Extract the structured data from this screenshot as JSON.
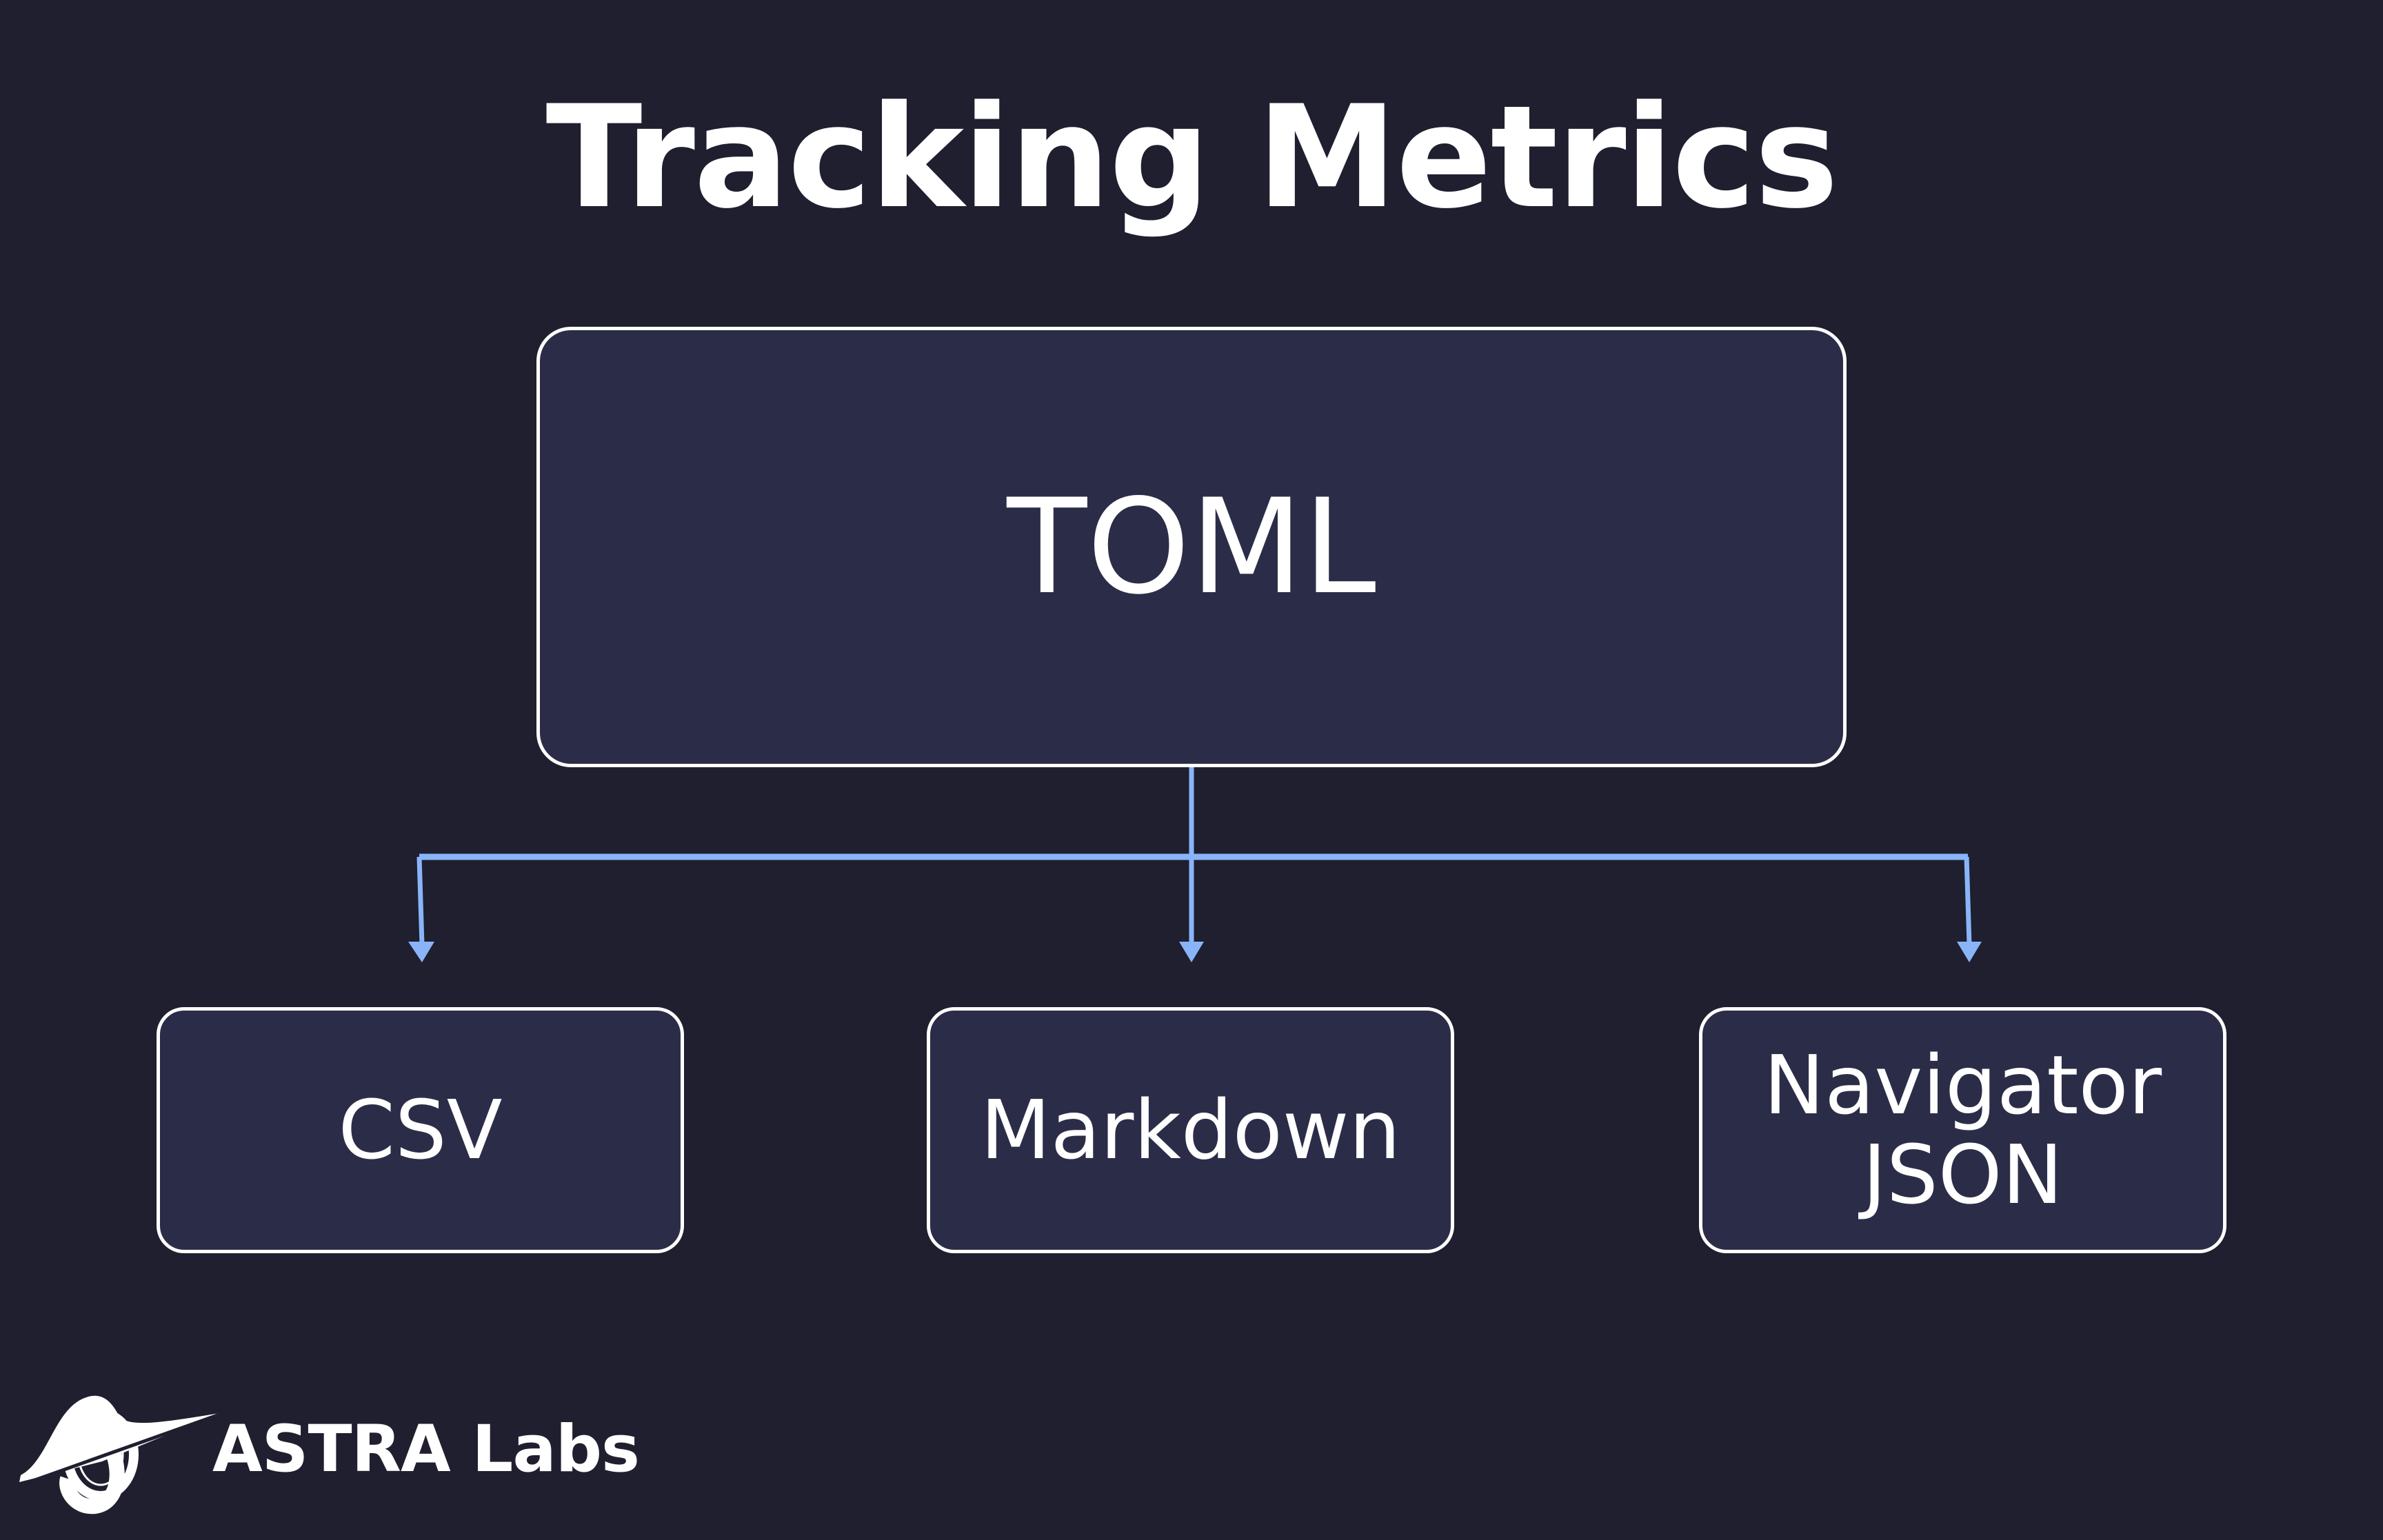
{
  "title": "Tracking Metrics",
  "root": {
    "label": "TOML"
  },
  "children": [
    {
      "label": "CSV"
    },
    {
      "label": "Markdown"
    },
    {
      "label": "Navigator JSON",
      "lines": [
        "Navigator",
        "JSON"
      ]
    }
  ],
  "brand": {
    "name": "ASTRA Labs"
  },
  "colors": {
    "background": "#1f1f2f",
    "box_fill": "#2b2d48",
    "connector": "#8ab4f8"
  }
}
